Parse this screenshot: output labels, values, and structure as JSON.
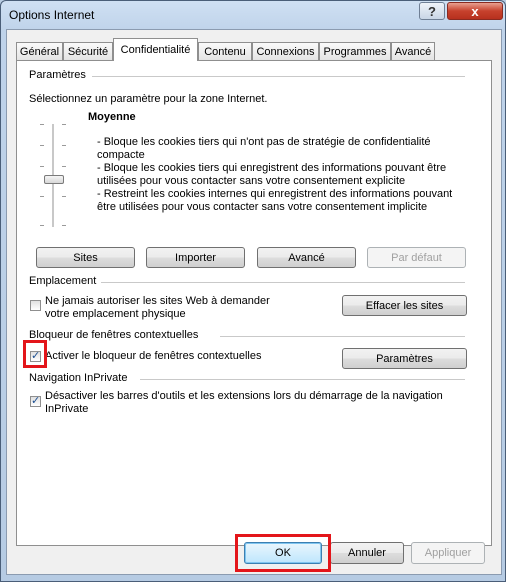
{
  "window": {
    "title": "Options Internet",
    "help_icon": "?",
    "close_icon": "x"
  },
  "tabs": [
    {
      "label": "Général",
      "active": false
    },
    {
      "label": "Sécurité",
      "active": false
    },
    {
      "label": "Confidentialité",
      "active": true
    },
    {
      "label": "Contenu",
      "active": false
    },
    {
      "label": "Connexions",
      "active": false
    },
    {
      "label": "Programmes",
      "active": false
    },
    {
      "label": "Avancé",
      "active": false
    }
  ],
  "parametres": {
    "title": "Paramètres",
    "instruction": "Sélectionnez un paramètre pour la zone Internet.",
    "level": "Moyenne",
    "desc_lines": [
      "- Bloque les cookies tiers qui n'ont pas de stratégie de confidentialité",
      "compacte",
      "- Bloque les cookies tiers qui enregistrent des informations pouvant être",
      "utilisées pour vous contacter sans votre consentement explicite",
      "- Restreint les cookies internes qui enregistrent des informations pouvant",
      "être utilisées pour vous contacter sans votre consentement implicite"
    ],
    "buttons": {
      "sites": "Sites",
      "importer": "Importer",
      "avance": "Avancé",
      "par_defaut": "Par défaut"
    }
  },
  "emplacement": {
    "title": "Emplacement",
    "checkbox_line1": "Ne jamais autoriser les sites Web à demander",
    "checkbox_line2": "votre emplacement physique",
    "checked": false,
    "button": "Effacer les sites"
  },
  "bloqueur": {
    "title": "Bloqueur de fenêtres contextuelles",
    "checkbox_label": "Activer le bloqueur de fenêtres contextuelles",
    "checked": true,
    "button": "Paramètres"
  },
  "inprivate": {
    "title": "Navigation InPrivate",
    "checkbox_line1": "Désactiver les barres d'outils et les extensions lors du démarrage de la navigation",
    "checkbox_line2": "InPrivate",
    "checked": true
  },
  "footer": {
    "ok": "OK",
    "annuler": "Annuler",
    "appliquer": "Appliquer"
  },
  "colors": {
    "highlight": "#e3151a",
    "check": "#1d4f91"
  }
}
